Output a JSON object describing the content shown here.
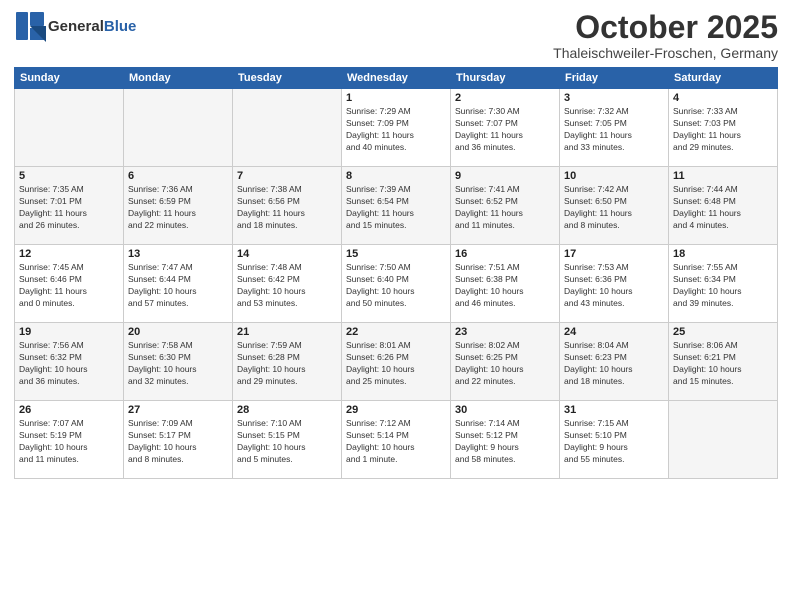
{
  "header": {
    "logo_general": "General",
    "logo_blue": "Blue",
    "month_title": "October 2025",
    "location": "Thaleischweiler-Froschen, Germany"
  },
  "days_of_week": [
    "Sunday",
    "Monday",
    "Tuesday",
    "Wednesday",
    "Thursday",
    "Friday",
    "Saturday"
  ],
  "weeks": [
    [
      {
        "day": "",
        "info": ""
      },
      {
        "day": "",
        "info": ""
      },
      {
        "day": "",
        "info": ""
      },
      {
        "day": "1",
        "info": "Sunrise: 7:29 AM\nSunset: 7:09 PM\nDaylight: 11 hours\nand 40 minutes."
      },
      {
        "day": "2",
        "info": "Sunrise: 7:30 AM\nSunset: 7:07 PM\nDaylight: 11 hours\nand 36 minutes."
      },
      {
        "day": "3",
        "info": "Sunrise: 7:32 AM\nSunset: 7:05 PM\nDaylight: 11 hours\nand 33 minutes."
      },
      {
        "day": "4",
        "info": "Sunrise: 7:33 AM\nSunset: 7:03 PM\nDaylight: 11 hours\nand 29 minutes."
      }
    ],
    [
      {
        "day": "5",
        "info": "Sunrise: 7:35 AM\nSunset: 7:01 PM\nDaylight: 11 hours\nand 26 minutes."
      },
      {
        "day": "6",
        "info": "Sunrise: 7:36 AM\nSunset: 6:59 PM\nDaylight: 11 hours\nand 22 minutes."
      },
      {
        "day": "7",
        "info": "Sunrise: 7:38 AM\nSunset: 6:56 PM\nDaylight: 11 hours\nand 18 minutes."
      },
      {
        "day": "8",
        "info": "Sunrise: 7:39 AM\nSunset: 6:54 PM\nDaylight: 11 hours\nand 15 minutes."
      },
      {
        "day": "9",
        "info": "Sunrise: 7:41 AM\nSunset: 6:52 PM\nDaylight: 11 hours\nand 11 minutes."
      },
      {
        "day": "10",
        "info": "Sunrise: 7:42 AM\nSunset: 6:50 PM\nDaylight: 11 hours\nand 8 minutes."
      },
      {
        "day": "11",
        "info": "Sunrise: 7:44 AM\nSunset: 6:48 PM\nDaylight: 11 hours\nand 4 minutes."
      }
    ],
    [
      {
        "day": "12",
        "info": "Sunrise: 7:45 AM\nSunset: 6:46 PM\nDaylight: 11 hours\nand 0 minutes."
      },
      {
        "day": "13",
        "info": "Sunrise: 7:47 AM\nSunset: 6:44 PM\nDaylight: 10 hours\nand 57 minutes."
      },
      {
        "day": "14",
        "info": "Sunrise: 7:48 AM\nSunset: 6:42 PM\nDaylight: 10 hours\nand 53 minutes."
      },
      {
        "day": "15",
        "info": "Sunrise: 7:50 AM\nSunset: 6:40 PM\nDaylight: 10 hours\nand 50 minutes."
      },
      {
        "day": "16",
        "info": "Sunrise: 7:51 AM\nSunset: 6:38 PM\nDaylight: 10 hours\nand 46 minutes."
      },
      {
        "day": "17",
        "info": "Sunrise: 7:53 AM\nSunset: 6:36 PM\nDaylight: 10 hours\nand 43 minutes."
      },
      {
        "day": "18",
        "info": "Sunrise: 7:55 AM\nSunset: 6:34 PM\nDaylight: 10 hours\nand 39 minutes."
      }
    ],
    [
      {
        "day": "19",
        "info": "Sunrise: 7:56 AM\nSunset: 6:32 PM\nDaylight: 10 hours\nand 36 minutes."
      },
      {
        "day": "20",
        "info": "Sunrise: 7:58 AM\nSunset: 6:30 PM\nDaylight: 10 hours\nand 32 minutes."
      },
      {
        "day": "21",
        "info": "Sunrise: 7:59 AM\nSunset: 6:28 PM\nDaylight: 10 hours\nand 29 minutes."
      },
      {
        "day": "22",
        "info": "Sunrise: 8:01 AM\nSunset: 6:26 PM\nDaylight: 10 hours\nand 25 minutes."
      },
      {
        "day": "23",
        "info": "Sunrise: 8:02 AM\nSunset: 6:25 PM\nDaylight: 10 hours\nand 22 minutes."
      },
      {
        "day": "24",
        "info": "Sunrise: 8:04 AM\nSunset: 6:23 PM\nDaylight: 10 hours\nand 18 minutes."
      },
      {
        "day": "25",
        "info": "Sunrise: 8:06 AM\nSunset: 6:21 PM\nDaylight: 10 hours\nand 15 minutes."
      }
    ],
    [
      {
        "day": "26",
        "info": "Sunrise: 7:07 AM\nSunset: 5:19 PM\nDaylight: 10 hours\nand 11 minutes."
      },
      {
        "day": "27",
        "info": "Sunrise: 7:09 AM\nSunset: 5:17 PM\nDaylight: 10 hours\nand 8 minutes."
      },
      {
        "day": "28",
        "info": "Sunrise: 7:10 AM\nSunset: 5:15 PM\nDaylight: 10 hours\nand 5 minutes."
      },
      {
        "day": "29",
        "info": "Sunrise: 7:12 AM\nSunset: 5:14 PM\nDaylight: 10 hours\nand 1 minute."
      },
      {
        "day": "30",
        "info": "Sunrise: 7:14 AM\nSunset: 5:12 PM\nDaylight: 9 hours\nand 58 minutes."
      },
      {
        "day": "31",
        "info": "Sunrise: 7:15 AM\nSunset: 5:10 PM\nDaylight: 9 hours\nand 55 minutes."
      },
      {
        "day": "",
        "info": ""
      }
    ]
  ]
}
